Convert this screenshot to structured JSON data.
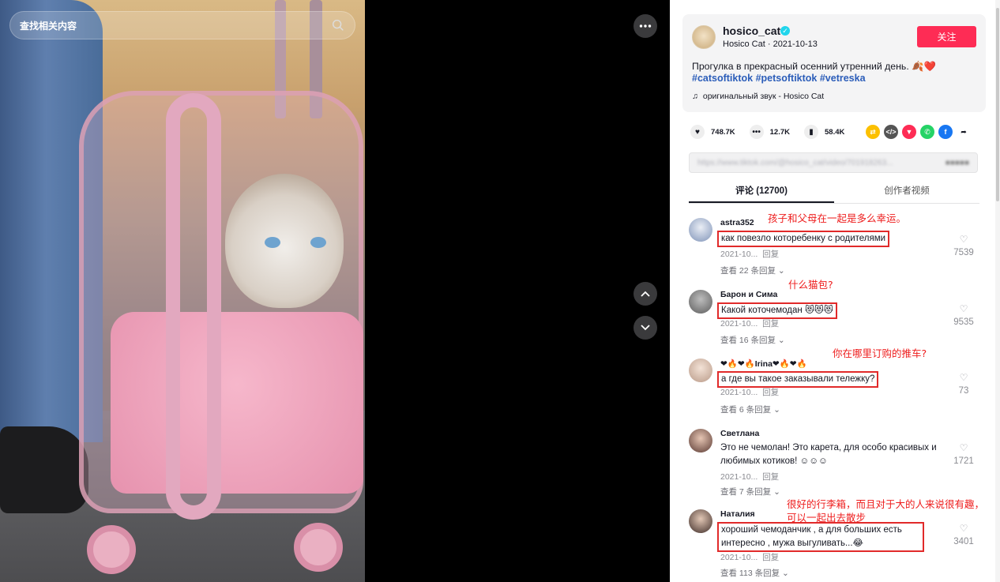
{
  "search": {
    "placeholder": "查找相关内容"
  },
  "post": {
    "author": "hosico_cat",
    "author_sub": "Hosico Cat · 2021-10-13",
    "follow_label": "关注",
    "caption": "Прогулка в прекрасный осенний утренний день. 🍂❤️",
    "hashtags": "#catsoftiktok #petsoftiktok #vetreska",
    "sound": "оригинальный звук - Hosico Cat"
  },
  "stats": {
    "likes": "748.7K",
    "comments": "12.7K",
    "saves": "58.4K"
  },
  "tabs": {
    "comments": "评论 (12700)",
    "creator_videos": "创作者视频"
  },
  "comments": [
    {
      "user": "astra352",
      "text": "как повезло которебенку с родителями",
      "date": "2021-10...",
      "reply_label": "回复",
      "replies": "查看 22 条回复",
      "likes": "7539",
      "annotation": "孩子和父母在一起是多么幸运。"
    },
    {
      "user": "Барон и Сима",
      "text": "Какой коточемодан 😻😻😻",
      "date": "2021-10...",
      "reply_label": "回复",
      "replies": "查看 16 条回复",
      "likes": "9535",
      "annotation": "什么猫包?"
    },
    {
      "user": "❤🔥❤🔥Irina❤🔥❤🔥",
      "text": "а где вы такое заказывали тележку?",
      "date": "2021-10...",
      "reply_label": "回复",
      "replies": "查看 6 条回复",
      "likes": "73",
      "annotation": "你在哪里订购的推车?"
    },
    {
      "user": "Светлана",
      "text": "Это не чемолан! Это карета, для особо красивых и любимых котиков! ☺☺☺",
      "date": "2021-10...",
      "reply_label": "回复",
      "replies": "查看 7 条回复",
      "likes": "1721",
      "annotation": ""
    },
    {
      "user": "Наталия",
      "text": "хороший чемоданчик , а для больших есть интересно , мужа выгуливать...😂",
      "date": "2021-10...",
      "reply_label": "回复",
      "replies": "查看 113 条回复",
      "likes": "3401",
      "annotation": "很好的行李箱，而且对于大的人来说很有趣，可以一起出去散步"
    }
  ],
  "colors": {
    "accent": "#fe2c55",
    "hashtag": "#2b5db9",
    "annotation": "#ee1d1d",
    "verified": "#20d5ec"
  }
}
